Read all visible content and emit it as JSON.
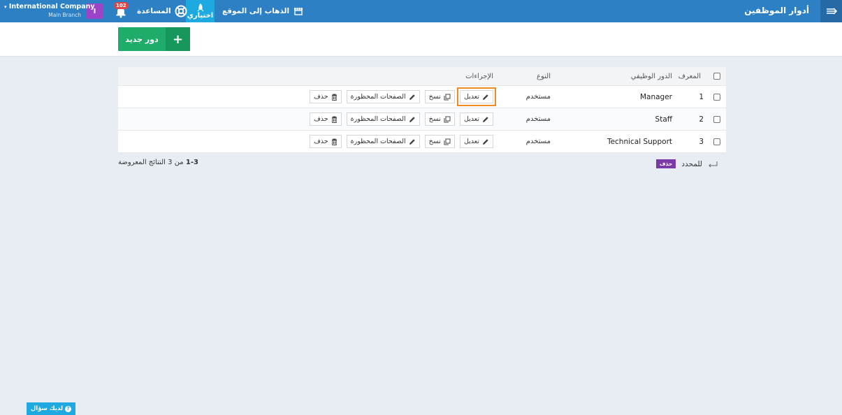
{
  "topbar": {
    "page_title": "أدوار الموظفين",
    "visit_site_label": "الذهاب إلى الموقع",
    "shortcuts_label": "اختياري",
    "help_label": "المساعدة",
    "notification_count": "102",
    "avatar_letter": "I",
    "company_name": "International Company",
    "branch_name": "Main Branch"
  },
  "toolbar": {
    "new_role_label": "دور جديد",
    "new_role_icon": "+"
  },
  "table": {
    "headers": {
      "id": "المعرف",
      "role": "الدور الوظيفي",
      "type": "النوع",
      "actions": "الإجراءات"
    },
    "action_labels": {
      "edit": "تعديل",
      "copy": "نسخ",
      "restricted_pages": "الصفحات المحظورة",
      "delete": "حذف"
    },
    "rows": [
      {
        "id": "1",
        "role": "Manager",
        "type": "مستخدم"
      },
      {
        "id": "2",
        "role": "Staff",
        "type": "مستخدم"
      },
      {
        "id": "3",
        "role": "Technical Support",
        "type": "مستخدم"
      }
    ]
  },
  "footer": {
    "bulk_label": "للمحدد",
    "bulk_delete_label": "حذف",
    "results_range": "1-3",
    "results_text": "من 3 النتائج المعروضة"
  },
  "help_widget": {
    "label": "لديك سؤال"
  },
  "colors": {
    "topbar": "#2d80c4",
    "accent_green": "#1fab6a",
    "shortcut_blue": "#1ea9e1",
    "avatar_purple": "#9b44c8",
    "highlight_orange": "#f08a24"
  }
}
